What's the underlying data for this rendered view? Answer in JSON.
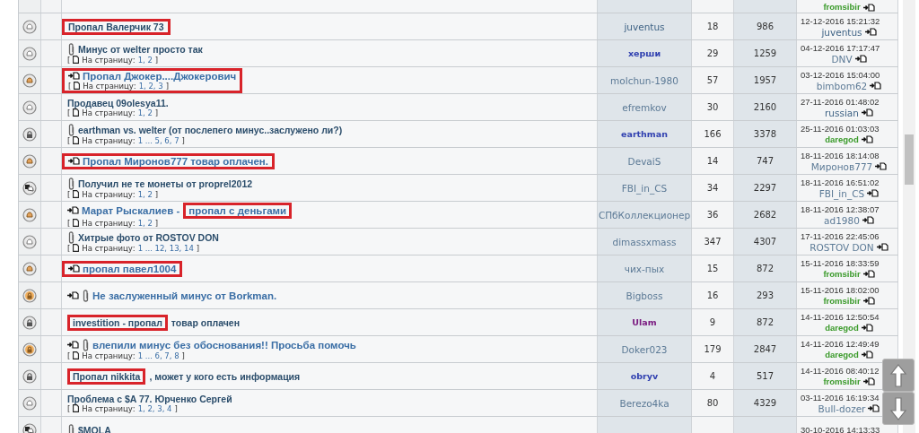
{
  "topics": [
    {
      "last_user": {
        "name": "fromsibir",
        "color": "#3a9a2a",
        "bold": true
      }
    },
    {
      "kind": "normal",
      "boxed": true,
      "new_post": false,
      "attachment": false,
      "title": [
        {
          "text": "Пропал Валерчик 73",
          "boxed": false
        }
      ],
      "author": {
        "name": "juventus",
        "color": "#3f6385",
        "bold": false
      },
      "replies": "18",
      "views": "986",
      "last_date": "12-12-2016 15:21:32",
      "last_user": {
        "name": "juventus",
        "color": "#3f6385",
        "bold": false
      }
    },
    {
      "kind": "normal",
      "boxed": false,
      "new_post": false,
      "attachment": true,
      "title": [
        {
          "text": "Минус от welter просто так",
          "boxed": false
        }
      ],
      "pages": {
        "open": "[",
        "label": "На страницу:",
        "links": "1, 2",
        "close": "]"
      },
      "author": {
        "name": "херши",
        "color": "#3040b0",
        "bold": true
      },
      "replies": "29",
      "views": "1259",
      "last_date": "04-12-2016 17:17:47",
      "last_user": {
        "name": "DNV",
        "color": "#5c7a96",
        "bold": false
      }
    },
    {
      "kind": "hot",
      "boxed": true,
      "new_post": true,
      "attachment": false,
      "title": [
        {
          "text": "Пропал Джокер....Джокерович",
          "boxed": false
        }
      ],
      "pages": {
        "open": "[",
        "label": "На страницу:",
        "links": "1, 2, 3",
        "close": "]"
      },
      "author": {
        "name": "molchun-1980",
        "color": "#5c7a96",
        "bold": false
      },
      "replies": "57",
      "views": "1957",
      "last_date": "03-12-2016 15:04:00",
      "last_user": {
        "name": "bimbom62",
        "color": "#5c7a96",
        "bold": false
      }
    },
    {
      "kind": "normal",
      "boxed": false,
      "new_post": false,
      "attachment": false,
      "title": [
        {
          "text": "Продавец 09olesya11.",
          "boxed": false
        }
      ],
      "pages": {
        "open": "[",
        "label": "На страницу:",
        "links": "1, 2",
        "close": "]"
      },
      "author": {
        "name": "efremkov",
        "color": "#5c7a96",
        "bold": false
      },
      "replies": "30",
      "views": "2160",
      "last_date": "27-11-2016 01:48:02",
      "last_user": {
        "name": "russian",
        "color": "#3f6385",
        "bold": false
      }
    },
    {
      "kind": "locked",
      "boxed": false,
      "new_post": false,
      "attachment": true,
      "title": [
        {
          "text": "earthman vs. welter (от послепего минус..заслужено ли?)",
          "boxed": false
        }
      ],
      "pages": {
        "open": "[",
        "label": "На страницу:",
        "links": "1 ... 5, 6, 7",
        "close": "]"
      },
      "author": {
        "name": "earthman",
        "color": "#3040b0",
        "bold": true
      },
      "replies": "166",
      "views": "3378",
      "last_date": "25-11-2016 01:03:03",
      "last_user": {
        "name": "daregod",
        "color": "#3a9a2a",
        "bold": true
      }
    },
    {
      "kind": "hot",
      "boxed": true,
      "new_post": true,
      "attachment": false,
      "title": [
        {
          "text": "Пропал Миронов777 товар оплачен.",
          "boxed": false
        }
      ],
      "author": {
        "name": "DevaiS",
        "color": "#5c7a96",
        "bold": false
      },
      "replies": "14",
      "views": "747",
      "last_date": "18-11-2016 18:14:08",
      "last_user": {
        "name": "Миронов777",
        "color": "#5c7a96",
        "bold": false
      }
    },
    {
      "kind": "moved",
      "boxed": false,
      "new_post": false,
      "attachment": true,
      "title": [
        {
          "text": "Получил не те монеты от proprel2012",
          "boxed": false
        }
      ],
      "pages": {
        "open": "[",
        "label": "На страницу:",
        "links": "1, 2",
        "close": "]"
      },
      "author": {
        "name": "FBI_in_CS",
        "color": "#5c7a96",
        "bold": false
      },
      "replies": "34",
      "views": "2297",
      "last_date": "18-11-2016 16:51:02",
      "last_user": {
        "name": "FBI_in_CS",
        "color": "#5c7a96",
        "bold": false
      }
    },
    {
      "kind": "hot",
      "boxed": false,
      "new_post": true,
      "attachment": false,
      "title": [
        {
          "text": "Марат Рыскалиев -",
          "boxed": false
        },
        {
          "text": "пропал с деньгами",
          "boxed": true
        }
      ],
      "pages": {
        "open": "[",
        "label": "На страницу:",
        "links": "1, 2",
        "close": "]"
      },
      "author": {
        "name": "СПбКоллекционер",
        "color": "#5c7a96",
        "bold": false
      },
      "replies": "36",
      "views": "2682",
      "last_date": "18-11-2016 12:38:07",
      "last_user": {
        "name": "ad1980",
        "color": "#5c7a96",
        "bold": false
      }
    },
    {
      "kind": "normal",
      "boxed": false,
      "new_post": false,
      "attachment": true,
      "title": [
        {
          "text": "Хитрые фото от ROSTOV DON",
          "boxed": false
        }
      ],
      "pages": {
        "open": "[",
        "label": "На страницу:",
        "links": "1 ... 12, 13, 14",
        "close": "]"
      },
      "author": {
        "name": "dimassxmass",
        "color": "#5c7a96",
        "bold": false
      },
      "replies": "347",
      "views": "4307",
      "last_date": "17-11-2016 22:45:06",
      "last_user": {
        "name": "ROSTOV DON",
        "color": "#5c7a96",
        "bold": false
      }
    },
    {
      "kind": "hot",
      "boxed": true,
      "new_post": true,
      "attachment": false,
      "title": [
        {
          "text": "пропал павел1004",
          "boxed": false
        }
      ],
      "author": {
        "name": "чих-пых",
        "color": "#5c7a96",
        "bold": false
      },
      "replies": "15",
      "views": "872",
      "last_date": "15-11-2016 18:33:59",
      "last_user": {
        "name": "fromsibir",
        "color": "#3a9a2a",
        "bold": true
      }
    },
    {
      "kind": "hot-locked",
      "boxed": false,
      "new_post": true,
      "attachment": true,
      "title": [
        {
          "text": "Не заслуженный минус от Borkman.",
          "boxed": false
        }
      ],
      "author": {
        "name": "Bigboss",
        "color": "#5c7a96",
        "bold": false
      },
      "replies": "16",
      "views": "293",
      "last_date": "15-11-2016 18:02:00",
      "last_user": {
        "name": "fromsibir",
        "color": "#3a9a2a",
        "bold": true
      }
    },
    {
      "kind": "locked",
      "boxed": false,
      "new_post": false,
      "attachment": false,
      "title": [
        {
          "text": "investition - пропал",
          "boxed": true
        },
        {
          "text": "товар оплачен",
          "boxed": false
        }
      ],
      "author": {
        "name": "Ulam",
        "color": "#7a1a80",
        "bold": true
      },
      "replies": "9",
      "views": "872",
      "last_date": "14-11-2016 12:50:54",
      "last_user": {
        "name": "daregod",
        "color": "#3a9a2a",
        "bold": true
      }
    },
    {
      "kind": "hot-locked",
      "boxed": false,
      "new_post": true,
      "attachment": true,
      "title": [
        {
          "text": "влепили минус без обоснования!! Просьба помочь",
          "boxed": false
        }
      ],
      "pages": {
        "open": "[",
        "label": "На страницу:",
        "links": "1 ... 6, 7, 8",
        "close": "]"
      },
      "author": {
        "name": "Doker023",
        "color": "#5c7a96",
        "bold": false
      },
      "replies": "179",
      "views": "2847",
      "last_date": "14-11-2016 12:49:49",
      "last_user": {
        "name": "daregod",
        "color": "#3a9a2a",
        "bold": true
      }
    },
    {
      "kind": "locked",
      "boxed": false,
      "new_post": false,
      "attachment": false,
      "title": [
        {
          "text": "Пропал nikkita",
          "boxed": true
        },
        {
          "text": ", может у кого есть информация",
          "boxed": false
        }
      ],
      "author": {
        "name": "obryv",
        "color": "#3040b0",
        "bold": true
      },
      "replies": "4",
      "views": "517",
      "last_date": "14-11-2016 08:40:12",
      "last_user": {
        "name": "fromsibir",
        "color": "#3a9a2a",
        "bold": true
      }
    },
    {
      "kind": "normal",
      "boxed": false,
      "new_post": false,
      "attachment": false,
      "title": [
        {
          "text": "Проблема с $A 77. Юрченко Сергей",
          "boxed": false
        }
      ],
      "pages": {
        "open": "[",
        "label": "На страницу:",
        "links": "1, 2, 3, 4",
        "close": "]"
      },
      "author": {
        "name": "Berezo4ka",
        "color": "#5c7a96",
        "bold": false
      },
      "replies": "80",
      "views": "4329",
      "last_date": "03-11-2016 16:19:34",
      "last_user": {
        "name": "Bull-dozer",
        "color": "#5c7a96",
        "bold": false
      }
    },
    {
      "kind": "moved",
      "boxed": false,
      "new_post": false,
      "attachment": true,
      "title": [
        {
          "text": "$MOLA",
          "boxed": false
        }
      ],
      "last_date": "30-10-2016 14:13:33"
    }
  ]
}
